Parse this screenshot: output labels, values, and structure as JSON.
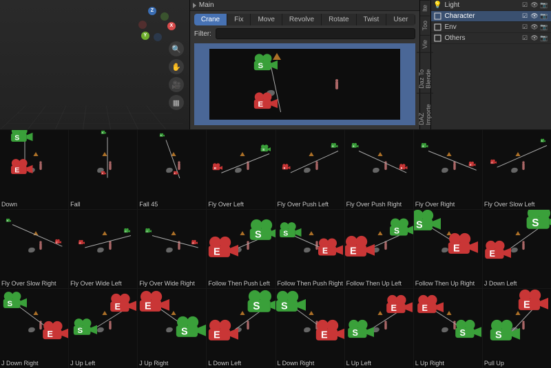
{
  "header": {
    "title": "Main"
  },
  "tabs": [
    {
      "label": "Crane",
      "active": true
    },
    {
      "label": "Fix"
    },
    {
      "label": "Move"
    },
    {
      "label": "Revolve"
    },
    {
      "label": "Rotate"
    },
    {
      "label": "Twist"
    },
    {
      "label": "User"
    }
  ],
  "filter": {
    "label": "Filter:",
    "value": ""
  },
  "vertical_tabs": [
    {
      "label": "Ite"
    },
    {
      "label": "Too"
    },
    {
      "label": "Vie"
    },
    {
      "label": "Daz To Blende"
    },
    {
      "label": "DAZ Importe"
    }
  ],
  "outliner": [
    {
      "icon": "light",
      "name": "Light",
      "sel": false
    },
    {
      "icon": "collection",
      "name": "Character",
      "sel": true
    },
    {
      "icon": "collection",
      "name": "Env",
      "sel": false
    },
    {
      "icon": "collection",
      "name": "Others",
      "sel": false
    }
  ],
  "view_tools": [
    {
      "name": "zoom",
      "glyph": "🔍"
    },
    {
      "name": "pan",
      "glyph": "✋"
    },
    {
      "name": "camera",
      "glyph": "🎥"
    },
    {
      "name": "perspective",
      "glyph": "▦"
    }
  ],
  "thumbs": [
    {
      "label": "Down",
      "sg": 0.22,
      "sx": 0.3,
      "sy": 0.1,
      "eg": 0.22,
      "ex": 0.3,
      "ey": 0.7,
      "big": true
    },
    {
      "label": "Fall",
      "sg": 0.1,
      "sx": 0.5,
      "sy": 0.05,
      "eg": 0.1,
      "ex": 0.5,
      "ey": 0.8
    },
    {
      "label": "Fall 45",
      "sg": 0.1,
      "sx": 0.35,
      "sy": 0.1,
      "eg": 0.1,
      "ex": 0.55,
      "ey": 0.8
    },
    {
      "label": "Fly Over Left",
      "sg": 0.2,
      "sx": 0.85,
      "sy": 0.35,
      "eg": 0.2,
      "ex": 0.15,
      "ey": 0.7
    },
    {
      "label": "Fly Over Push Left",
      "sg": 0.14,
      "sx": 0.85,
      "sy": 0.3,
      "eg": 0.16,
      "ex": 0.15,
      "ey": 0.7
    },
    {
      "label": "Fly Over Push Right",
      "sg": 0.14,
      "sx": 0.15,
      "sy": 0.3,
      "eg": 0.16,
      "ex": 0.85,
      "ey": 0.7
    },
    {
      "label": "Fly Over Right",
      "sg": 0.14,
      "sx": 0.15,
      "sy": 0.3,
      "eg": 0.14,
      "ex": 0.85,
      "ey": 0.65
    },
    {
      "label": "Fly Over Slow Left",
      "sg": 0.1,
      "sx": 0.88,
      "sy": 0.2,
      "eg": 0.12,
      "ex": 0.15,
      "ey": 0.6
    },
    {
      "label": "Fly Over Slow Right",
      "sg": 0.1,
      "sx": 0.12,
      "sy": 0.2,
      "eg": 0.12,
      "ex": 0.85,
      "ey": 0.6
    },
    {
      "label": "Fly Over Wide Left",
      "sg": 0.12,
      "sx": 0.85,
      "sy": 0.4,
      "eg": 0.12,
      "ex": 0.18,
      "ey": 0.62
    },
    {
      "label": "Fly Over Wide Right",
      "sg": 0.12,
      "sx": 0.15,
      "sy": 0.4,
      "eg": 0.12,
      "ex": 0.82,
      "ey": 0.62
    },
    {
      "label": "Follow Then Push Left",
      "sg": 0.3,
      "sx": 0.82,
      "sy": 0.4,
      "eg": 0.3,
      "ex": 0.22,
      "ey": 0.72,
      "big": true
    },
    {
      "label": "Follow Then Push Right",
      "sg": 0.22,
      "sx": 0.2,
      "sy": 0.4,
      "eg": 0.25,
      "ex": 0.78,
      "ey": 0.72,
      "big": true
    },
    {
      "label": "Follow Then Up Left",
      "sg": 0.25,
      "sx": 0.82,
      "sy": 0.35,
      "eg": 0.3,
      "ex": 0.2,
      "ey": 0.7,
      "big": true
    },
    {
      "label": "Follow Then Up Right",
      "sg": 0.3,
      "sx": 0.15,
      "sy": 0.22,
      "eg": 0.3,
      "ex": 0.7,
      "ey": 0.65,
      "big": true
    },
    {
      "label": "J Down Left",
      "sg": 0.32,
      "sx": 0.85,
      "sy": 0.18,
      "eg": 0.26,
      "ex": 0.2,
      "ey": 0.76,
      "big": true
    },
    {
      "label": "J Down Right",
      "sg": 0.24,
      "sx": 0.2,
      "sy": 0.22,
      "eg": 0.26,
      "ex": 0.8,
      "ey": 0.78,
      "big": true
    },
    {
      "label": "J Up Left",
      "sg": 0.24,
      "sx": 0.22,
      "sy": 0.72,
      "eg": 0.26,
      "ex": 0.78,
      "ey": 0.28,
      "big": true
    },
    {
      "label": "J Up Right",
      "sg": 0.3,
      "sx": 0.75,
      "sy": 0.72,
      "eg": 0.3,
      "ex": 0.22,
      "ey": 0.25,
      "big": true
    },
    {
      "label": "L Down Left",
      "sg": 0.32,
      "sx": 0.8,
      "sy": 0.25,
      "eg": 0.3,
      "ex": 0.22,
      "ey": 0.78,
      "big": true
    },
    {
      "label": "L Down Right",
      "sg": 0.3,
      "sx": 0.2,
      "sy": 0.25,
      "eg": 0.3,
      "ex": 0.78,
      "ey": 0.78,
      "big": true
    },
    {
      "label": "L Up Left",
      "sg": 0.26,
      "sx": 0.22,
      "sy": 0.75,
      "eg": 0.26,
      "ex": 0.78,
      "ey": 0.3,
      "big": true
    },
    {
      "label": "L Up Right",
      "sg": 0.26,
      "sx": 0.78,
      "sy": 0.75,
      "eg": 0.26,
      "ex": 0.22,
      "ey": 0.3,
      "big": true
    },
    {
      "label": "Pull Up",
      "sg": 0.3,
      "sx": 0.3,
      "sy": 0.78,
      "eg": 0.3,
      "ex": 0.72,
      "ey": 0.22,
      "big": true
    }
  ]
}
